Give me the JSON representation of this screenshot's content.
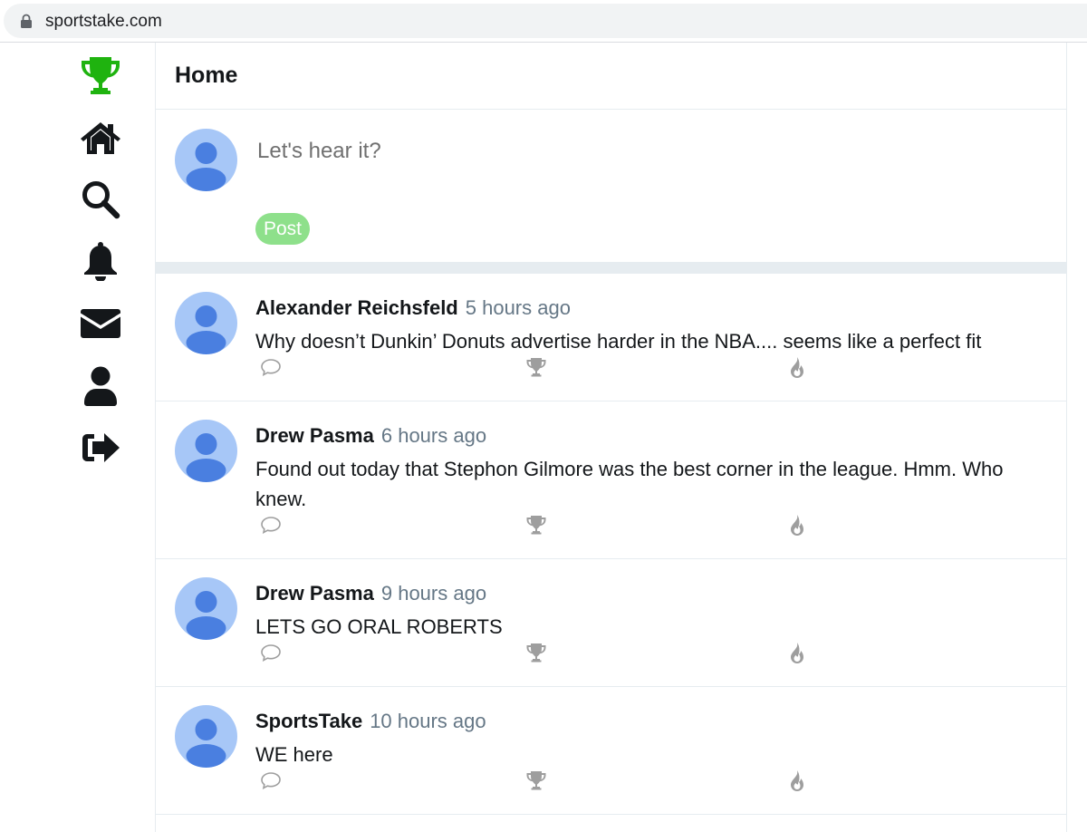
{
  "browser": {
    "url": "sportstake.com"
  },
  "sidebar": {
    "items": [
      {
        "icon": "trophy-icon"
      },
      {
        "icon": "home-icon"
      },
      {
        "icon": "search-icon"
      },
      {
        "icon": "bell-icon"
      },
      {
        "icon": "envelope-icon"
      },
      {
        "icon": "user-icon"
      },
      {
        "icon": "sign-out-icon"
      }
    ],
    "brand_color": "#1fb30f"
  },
  "header": {
    "title": "Home"
  },
  "composer": {
    "placeholder": "Let's hear it?",
    "post_label": "Post",
    "post_color": "#8ee08b"
  },
  "feed": {
    "posts": [
      {
        "author": "Alexander Reichsfeld",
        "time": "5 hours ago",
        "text": "Why doesn’t Dunkin’ Donuts advertise harder in the NBA.... seems like a perfect fit"
      },
      {
        "author": "Drew Pasma",
        "time": "6 hours ago",
        "text": "Found out today that Stephon Gilmore was the best corner in the league. Hmm. Who knew."
      },
      {
        "author": "Drew Pasma",
        "time": "9 hours ago",
        "text": "LETS GO ORAL ROBERTS"
      },
      {
        "author": "SportsTake",
        "time": "10 hours ago",
        "text": "WE here"
      }
    ],
    "actions": [
      "comment-icon",
      "trophy-icon",
      "fire-icon"
    ]
  }
}
